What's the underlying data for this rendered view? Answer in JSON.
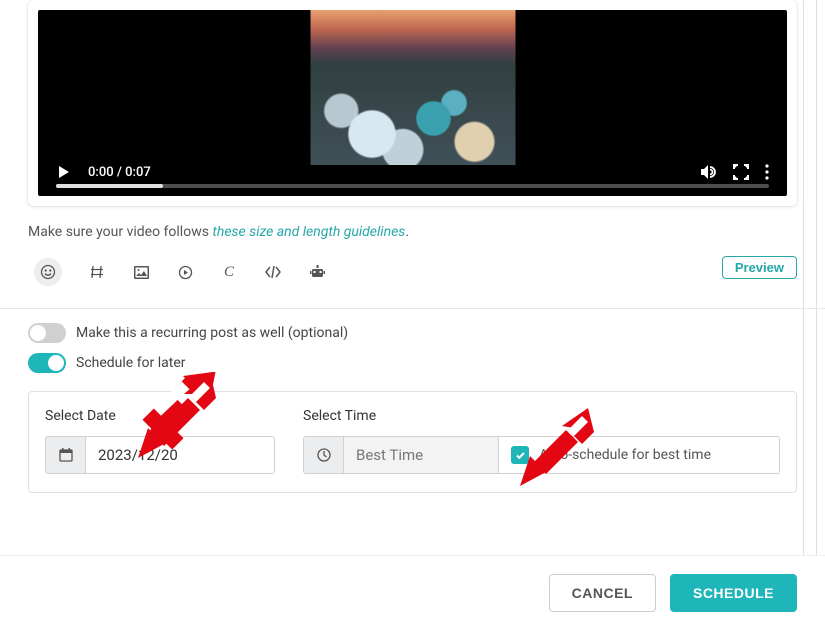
{
  "video": {
    "current_time": "0:00",
    "duration": "0:07"
  },
  "guideline": {
    "prefix": "Make sure your video follows ",
    "link_text": "these size and length guidelines",
    "suffix": "."
  },
  "toolbar": {
    "preview": "Preview"
  },
  "toggles": {
    "recurring_label": "Make this a recurring post as well (optional)",
    "schedule_later_label": "Schedule for later"
  },
  "schedule": {
    "date_label": "Select Date",
    "date_value": "2023/12/20",
    "time_label": "Select Time",
    "time_placeholder": "Best Time",
    "auto_label": "Auto-schedule for best time"
  },
  "footer": {
    "cancel": "CANCEL",
    "schedule": "SCHEDULE"
  },
  "colors": {
    "accent": "#1fb6ba",
    "arrow": "#e30613"
  }
}
